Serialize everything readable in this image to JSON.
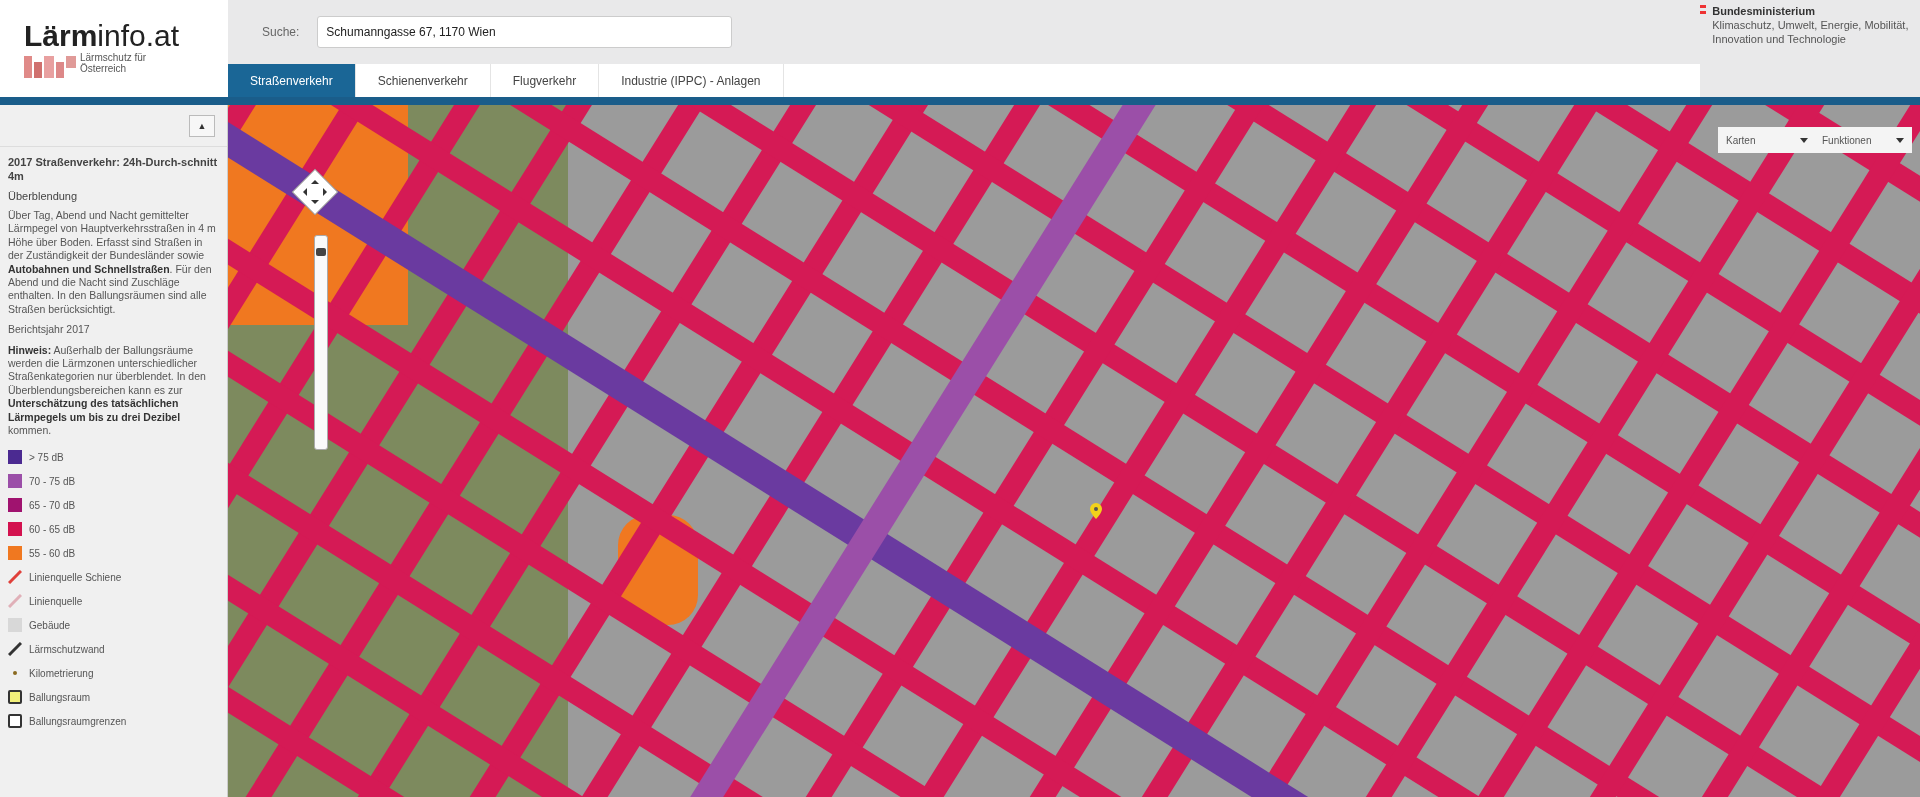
{
  "header": {
    "logo": {
      "title": "**Lärm**info.at",
      "subtitle": "Lärmschutz für Österreich"
    },
    "search": {
      "label": "Suche:",
      "value": "Schumanngasse 67, 1170 Wien"
    },
    "ministry": {
      "name": "Bundesministerium",
      "department": "Klimaschutz, Umwelt, Energie, Mobilität, Innovation und Technologie"
    }
  },
  "tabs": [
    {
      "label": "Straßenverkehr",
      "selected": true
    },
    {
      "label": "Schienenverkehr",
      "selected": false
    },
    {
      "label": "Flugverkehr",
      "selected": false
    },
    {
      "label": "Industrie (IPPC) - Anlagen",
      "selected": false
    }
  ],
  "sidebar": {
    "collapse": "▲",
    "title": "2017 Straßenverkehr: 24h-Durch-schnitt 4m",
    "subtitle": "Überblendung",
    "paragraphs": [
      "Über Tag, Abend und Nacht gemittelter Lärmpegel von Hauptverkehrsstraßen in 4 m Höhe über Boden. Erfasst sind Straßen in der Zuständigkeit der Bundesländer sowie **Autobahnen und Schnellstraßen**. Für den Abend und die Nacht sind Zuschläge enthalten. In den Ballungsräumen sind alle Straßen berücksichtigt.",
      "Berichtsjahr 2017",
      "**Hinweis:** Außerhalb der Ballungsräume werden die Lärmzonen unterschiedlicher Straßenkategorien nur überblendet. In den Überblendungsbereichen kann es zur **Unterschätzung des tatsächlichen Lärmpegels um bis zu drei Dezibel** kommen."
    ],
    "legend": [
      {
        "kind": "swatch",
        "label": "> 75 dB",
        "color": "#4b2a91"
      },
      {
        "kind": "swatch",
        "label": "70 - 75 dB",
        "color": "#9b4fa8"
      },
      {
        "kind": "swatch",
        "label": "65 - 70 dB",
        "color": "#a0136f"
      },
      {
        "kind": "swatch",
        "label": "60 - 65 dB",
        "color": "#d3124f"
      },
      {
        "kind": "swatch",
        "label": "55 - 60 dB",
        "color": "#f07820"
      },
      {
        "kind": "line",
        "label": "Linienquelle Schiene",
        "color": "#e0403a"
      },
      {
        "kind": "line",
        "label": "Linienquelle",
        "color": "#e0b0b8"
      },
      {
        "kind": "swatch",
        "label": "Gebäude",
        "color": "#d8d8d8"
      },
      {
        "kind": "line",
        "label": "Lärmschutzwand",
        "color": "#333333"
      },
      {
        "kind": "dot",
        "label": "Kilometrierung",
        "color": "#8a6a20"
      },
      {
        "kind": "outline",
        "label": "Ballungsraum",
        "color": "#f2f07a"
      },
      {
        "kind": "outline",
        "label": "Ballungsraumgrenzen",
        "color": "#ffffff"
      }
    ]
  },
  "map": {
    "layer_select": "Karten",
    "function_select": "Funktionen",
    "zoom": {
      "level": 0.95
    }
  }
}
